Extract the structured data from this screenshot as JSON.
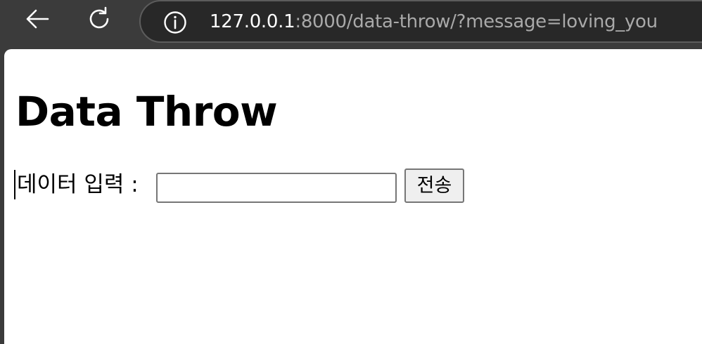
{
  "browser": {
    "back_icon": "back-arrow-icon",
    "reload_icon": "reload-icon",
    "info_icon": "info-icon",
    "url_host": "127.0.0.1",
    "url_rest": ":8000/data-throw/?message=loving_you"
  },
  "page": {
    "title": "Data Throw",
    "form": {
      "label": "데이터 입력 :",
      "input_value": "",
      "input_placeholder": "",
      "submit_label": "전송"
    }
  },
  "colors": {
    "chrome_bg": "#3b3b3b",
    "address_bar_bg": "#282828",
    "url_host": "#ffffff",
    "url_rest": "#a9a9a9",
    "page_bg": "#ffffff"
  }
}
